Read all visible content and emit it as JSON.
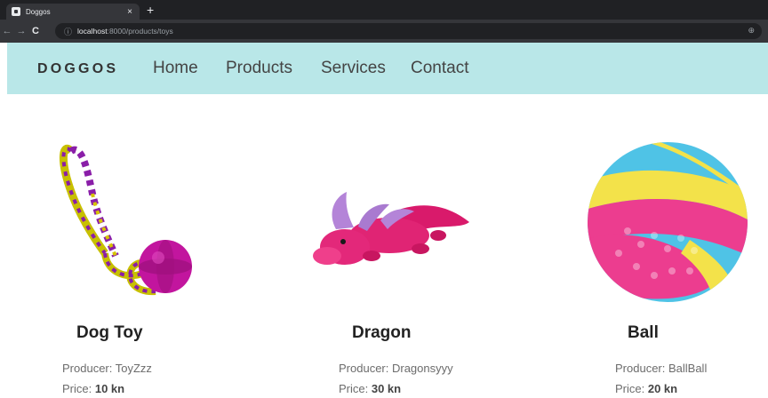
{
  "browser": {
    "tab_title": "Doggos",
    "tab_close": "×",
    "new_tab": "+",
    "url_host": "localhost",
    "url_path": ":8000/products/toys"
  },
  "site": {
    "brand": "DOGGOS",
    "nav": [
      "Home",
      "Products",
      "Services",
      "Contact"
    ]
  },
  "products": [
    {
      "name": "Dog Toy",
      "producer": "Producer: ToyZzz",
      "price_label": "Price:",
      "price": "10 kn"
    },
    {
      "name": "Dragon",
      "producer": "Producer: Dragonsyyy",
      "price_label": "Price:",
      "price": "30 kn"
    },
    {
      "name": "Ball",
      "producer": "Producer: BallBall",
      "price_label": "Price:",
      "price": "20 kn"
    }
  ],
  "colors": {
    "nav_bg": "#b9e7e8",
    "chrome_dark": "#202124",
    "toolbar": "#35363a"
  }
}
